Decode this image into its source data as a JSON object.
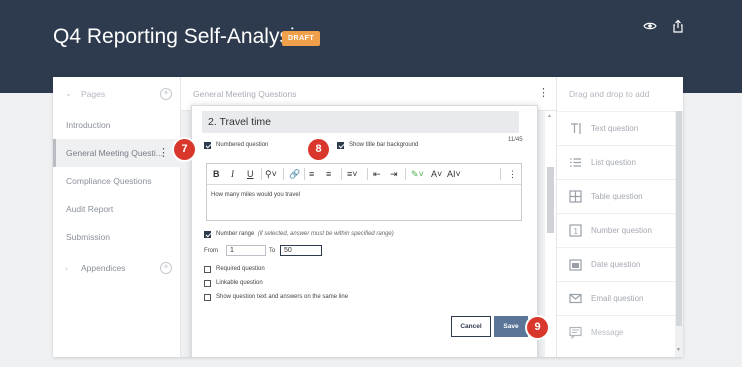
{
  "header": {
    "title": "Q4 Reporting Self-Analysis",
    "badge": "DRAFT",
    "icons": [
      "eye-icon",
      "share-icon"
    ]
  },
  "pages_panel": {
    "heading": "Pages",
    "items": [
      {
        "label": "Introduction",
        "active": false
      },
      {
        "label": "General Meeting Questi...",
        "active": true
      },
      {
        "label": "Compliance Questions",
        "active": false
      },
      {
        "label": "Audit Report",
        "active": false
      },
      {
        "label": "Submission",
        "active": false
      }
    ],
    "appendices": "Appendices"
  },
  "center": {
    "heading": "General Meeting Questions"
  },
  "question": {
    "title": "2. Travel time",
    "char_count": "11/45",
    "numbered_label": "Numbered question",
    "title_bar_label": "Show title bar background",
    "editor_text": "How many miles would you travel",
    "number_range_label": "Number range",
    "number_range_hint": "(if selected, answer must be within specified range)",
    "from_label": "From",
    "from_value": "1",
    "to_label": "To",
    "to_value": "50",
    "required_label": "Required question",
    "linkable_label": "Linkable question",
    "same_line_label": "Show question text and answers on the same line",
    "cancel_label": "Cancel",
    "save_label": "Save"
  },
  "markers": {
    "m7": "7",
    "m8": "8",
    "m9": "9"
  },
  "palette": {
    "heading": "Drag and drop to add",
    "items": [
      {
        "label": "Text question",
        "icon": "text-icon"
      },
      {
        "label": "List question",
        "icon": "list-icon"
      },
      {
        "label": "Table question",
        "icon": "table-icon"
      },
      {
        "label": "Number question",
        "icon": "number-icon"
      },
      {
        "label": "Date question",
        "icon": "calendar-icon"
      },
      {
        "label": "Email question",
        "icon": "email-icon"
      },
      {
        "label": "Message",
        "icon": "message-icon"
      }
    ]
  },
  "colors": {
    "header_bg": "#2e3b4e",
    "badge": "#f0a04b",
    "marker": "#d9362c",
    "save_button": "#5a7597"
  }
}
